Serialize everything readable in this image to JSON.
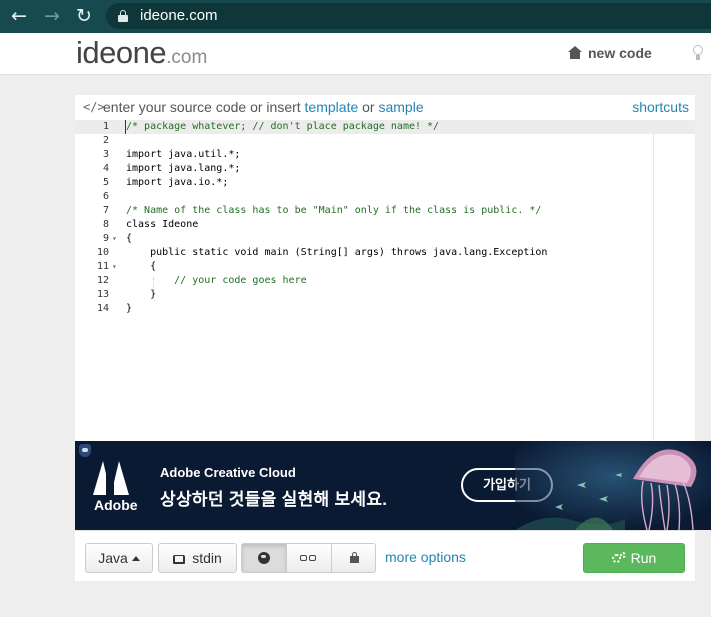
{
  "browser": {
    "url": "ideone.com"
  },
  "header": {
    "logo_main": "ideone",
    "logo_suffix": ".com",
    "new_code_label": "new code"
  },
  "editor": {
    "prompt_prefix": "enter your source code or insert",
    "template_link": "template",
    "or_text": "or",
    "sample_link": "sample",
    "shortcuts_label": "shortcuts",
    "lines": [
      {
        "n": "1",
        "text": "/* package whatever; // don't place package name! */"
      },
      {
        "n": "2",
        "text": ""
      },
      {
        "n": "3",
        "text": "import java.util.*;"
      },
      {
        "n": "4",
        "text": "import java.lang.*;"
      },
      {
        "n": "5",
        "text": "import java.io.*;"
      },
      {
        "n": "6",
        "text": ""
      },
      {
        "n": "7",
        "text": "/* Name of the class has to be \"Main\" only if the class is public. */"
      },
      {
        "n": "8",
        "text": "class Ideone"
      },
      {
        "n": "9",
        "text": "{"
      },
      {
        "n": "10",
        "text": "    public static void main (String[] args) throws java.lang.Exception"
      },
      {
        "n": "11",
        "text": "    {"
      },
      {
        "n": "12",
        "text": "        // your code goes here"
      },
      {
        "n": "13",
        "text": "    }"
      },
      {
        "n": "14",
        "text": "}"
      }
    ]
  },
  "ad": {
    "brand": "Adobe",
    "title": "Adobe Creative Cloud",
    "subtitle": "상상하던 것들을 실현해 보세요.",
    "cta": "가입하기"
  },
  "toolbar": {
    "language": "Java",
    "stdin_label": "stdin",
    "more_options_label": "more options",
    "run_label": "Run"
  },
  "colors": {
    "browser_bar": "#174a4e",
    "link": "#2585b2",
    "run_green": "#5cb85c",
    "ad_background": "#0b1a33"
  },
  "icons": {
    "back": "arrow-left-icon",
    "forward": "arrow-right-icon",
    "reload": "reload-icon",
    "lock": "lock-icon",
    "home": "home-icon",
    "bulb": "lightbulb-icon",
    "code": "code-icon",
    "stdin": "hdd-icon",
    "public": "globe-icon",
    "secret": "glasses-icon",
    "private": "lock-icon",
    "run": "gears-icon"
  }
}
